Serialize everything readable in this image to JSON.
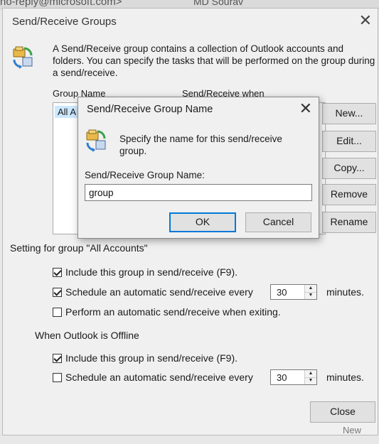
{
  "background": {
    "email_fragment": "no-reply@microsoft.com>",
    "sender_fragment": "MD Sourav",
    "new_label": "New"
  },
  "dialog": {
    "title": "Send/Receive Groups",
    "description": "A Send/Receive group contains a collection of Outlook accounts and folders. You can specify the tasks that will be performed on the group during a send/receive.",
    "columns": {
      "group_name": "Group Name",
      "send_receive_when": "Send/Receive when"
    },
    "list_items": [
      "All A"
    ],
    "buttons": {
      "new": "New...",
      "edit": "Edit...",
      "copy": "Copy...",
      "remove": "Remove",
      "rename": "Rename",
      "close": "Close"
    },
    "settings_section": "Setting for group \"All Accounts\"",
    "online": {
      "include": {
        "label": "Include this group in send/receive (F9).",
        "checked": true
      },
      "schedule": {
        "label": "Schedule an automatic send/receive every",
        "checked": true,
        "value": "30",
        "unit": "minutes."
      },
      "on_exit": {
        "label": "Perform an automatic send/receive when exiting.",
        "checked": false
      }
    },
    "offline_section": "When Outlook is Offline",
    "offline": {
      "include": {
        "label": "Include this group in send/receive (F9).",
        "checked": true
      },
      "schedule": {
        "label": "Schedule an automatic send/receive every",
        "checked": false,
        "value": "30",
        "unit": "minutes."
      }
    }
  },
  "modal": {
    "title": "Send/Receive Group Name",
    "instruction": "Specify the name for this send/receive group.",
    "field_label": "Send/Receive Group Name:",
    "field_value": "group",
    "ok": "OK",
    "cancel": "Cancel"
  },
  "icons": [
    "send-receive-icon",
    "close-icon",
    "spin-up-icon",
    "spin-down-icon"
  ]
}
